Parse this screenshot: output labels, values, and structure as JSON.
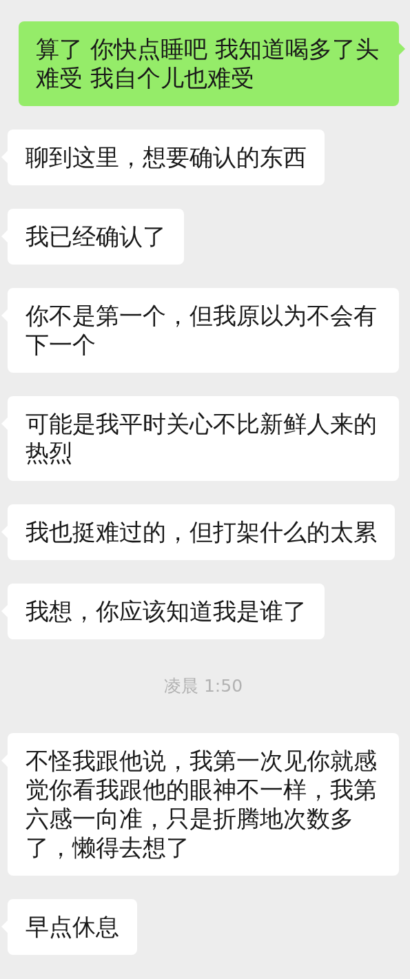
{
  "messages": [
    {
      "kind": "sent",
      "text": "算了 你快点睡吧 我知道喝多了头难受 我自个儿也难受"
    },
    {
      "kind": "received",
      "text": "聊到这里，想要确认的东西"
    },
    {
      "kind": "received",
      "text": "我已经确认了"
    },
    {
      "kind": "received",
      "text": "你不是第一个，但我原以为不会有下一个"
    },
    {
      "kind": "received",
      "text": "可能是我平时关心不比新鲜人来的热烈"
    },
    {
      "kind": "received",
      "text": "我也挺难过的，但打架什么的太累"
    },
    {
      "kind": "received",
      "text": "我想，你应该知道我是谁了"
    },
    {
      "kind": "time",
      "text": "凌晨 1:50"
    },
    {
      "kind": "received",
      "text": "不怪我跟他说，我第一次见你就感觉你看我跟他的眼神不一样，我第六感一向准，只是折腾地次数多了，懒得去想了"
    },
    {
      "kind": "received",
      "text": "早点休息"
    }
  ]
}
